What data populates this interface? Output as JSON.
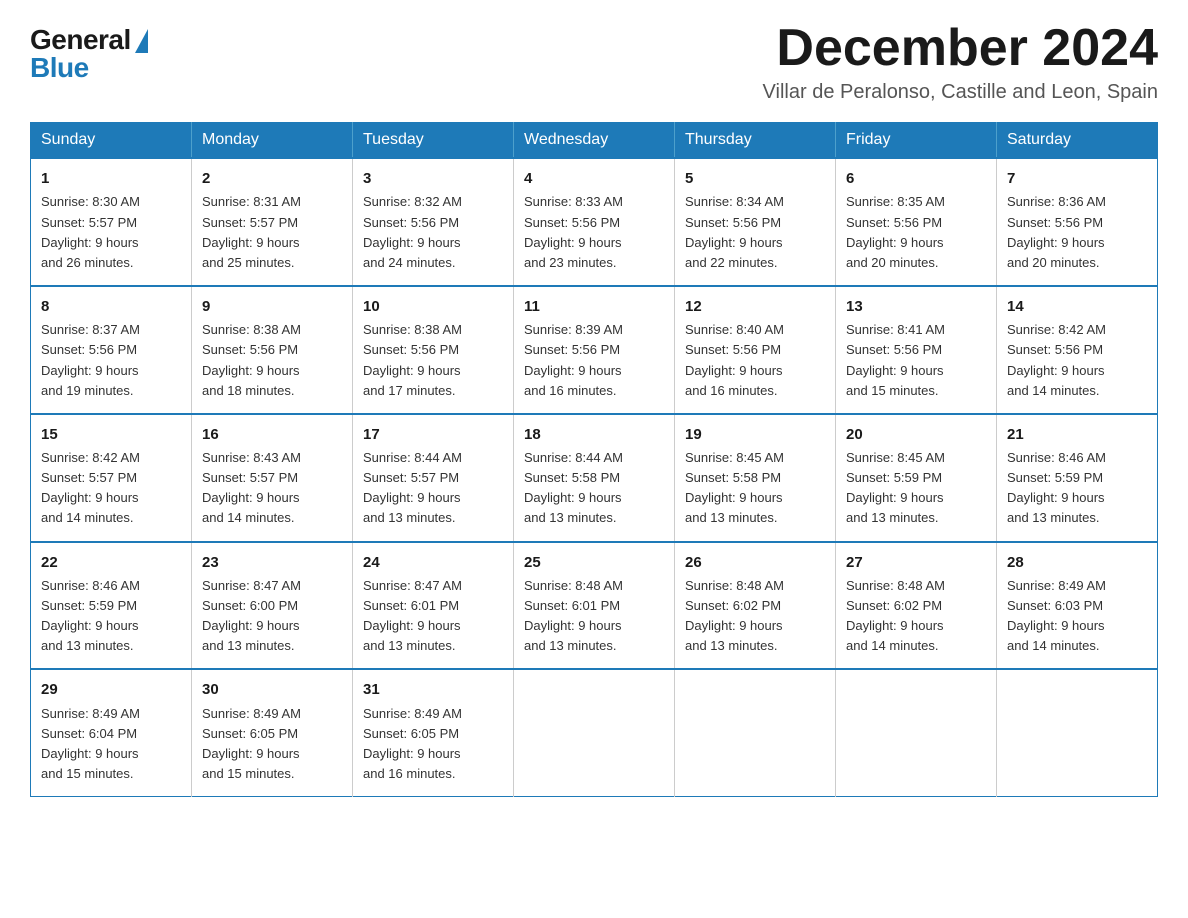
{
  "logo": {
    "general": "General",
    "blue": "Blue"
  },
  "title": "December 2024",
  "subtitle": "Villar de Peralonso, Castille and Leon, Spain",
  "days_header": [
    "Sunday",
    "Monday",
    "Tuesday",
    "Wednesday",
    "Thursday",
    "Friday",
    "Saturday"
  ],
  "weeks": [
    [
      {
        "day": "1",
        "info": "Sunrise: 8:30 AM\nSunset: 5:57 PM\nDaylight: 9 hours\nand 26 minutes."
      },
      {
        "day": "2",
        "info": "Sunrise: 8:31 AM\nSunset: 5:57 PM\nDaylight: 9 hours\nand 25 minutes."
      },
      {
        "day": "3",
        "info": "Sunrise: 8:32 AM\nSunset: 5:56 PM\nDaylight: 9 hours\nand 24 minutes."
      },
      {
        "day": "4",
        "info": "Sunrise: 8:33 AM\nSunset: 5:56 PM\nDaylight: 9 hours\nand 23 minutes."
      },
      {
        "day": "5",
        "info": "Sunrise: 8:34 AM\nSunset: 5:56 PM\nDaylight: 9 hours\nand 22 minutes."
      },
      {
        "day": "6",
        "info": "Sunrise: 8:35 AM\nSunset: 5:56 PM\nDaylight: 9 hours\nand 20 minutes."
      },
      {
        "day": "7",
        "info": "Sunrise: 8:36 AM\nSunset: 5:56 PM\nDaylight: 9 hours\nand 20 minutes."
      }
    ],
    [
      {
        "day": "8",
        "info": "Sunrise: 8:37 AM\nSunset: 5:56 PM\nDaylight: 9 hours\nand 19 minutes."
      },
      {
        "day": "9",
        "info": "Sunrise: 8:38 AM\nSunset: 5:56 PM\nDaylight: 9 hours\nand 18 minutes."
      },
      {
        "day": "10",
        "info": "Sunrise: 8:38 AM\nSunset: 5:56 PM\nDaylight: 9 hours\nand 17 minutes."
      },
      {
        "day": "11",
        "info": "Sunrise: 8:39 AM\nSunset: 5:56 PM\nDaylight: 9 hours\nand 16 minutes."
      },
      {
        "day": "12",
        "info": "Sunrise: 8:40 AM\nSunset: 5:56 PM\nDaylight: 9 hours\nand 16 minutes."
      },
      {
        "day": "13",
        "info": "Sunrise: 8:41 AM\nSunset: 5:56 PM\nDaylight: 9 hours\nand 15 minutes."
      },
      {
        "day": "14",
        "info": "Sunrise: 8:42 AM\nSunset: 5:56 PM\nDaylight: 9 hours\nand 14 minutes."
      }
    ],
    [
      {
        "day": "15",
        "info": "Sunrise: 8:42 AM\nSunset: 5:57 PM\nDaylight: 9 hours\nand 14 minutes."
      },
      {
        "day": "16",
        "info": "Sunrise: 8:43 AM\nSunset: 5:57 PM\nDaylight: 9 hours\nand 14 minutes."
      },
      {
        "day": "17",
        "info": "Sunrise: 8:44 AM\nSunset: 5:57 PM\nDaylight: 9 hours\nand 13 minutes."
      },
      {
        "day": "18",
        "info": "Sunrise: 8:44 AM\nSunset: 5:58 PM\nDaylight: 9 hours\nand 13 minutes."
      },
      {
        "day": "19",
        "info": "Sunrise: 8:45 AM\nSunset: 5:58 PM\nDaylight: 9 hours\nand 13 minutes."
      },
      {
        "day": "20",
        "info": "Sunrise: 8:45 AM\nSunset: 5:59 PM\nDaylight: 9 hours\nand 13 minutes."
      },
      {
        "day": "21",
        "info": "Sunrise: 8:46 AM\nSunset: 5:59 PM\nDaylight: 9 hours\nand 13 minutes."
      }
    ],
    [
      {
        "day": "22",
        "info": "Sunrise: 8:46 AM\nSunset: 5:59 PM\nDaylight: 9 hours\nand 13 minutes."
      },
      {
        "day": "23",
        "info": "Sunrise: 8:47 AM\nSunset: 6:00 PM\nDaylight: 9 hours\nand 13 minutes."
      },
      {
        "day": "24",
        "info": "Sunrise: 8:47 AM\nSunset: 6:01 PM\nDaylight: 9 hours\nand 13 minutes."
      },
      {
        "day": "25",
        "info": "Sunrise: 8:48 AM\nSunset: 6:01 PM\nDaylight: 9 hours\nand 13 minutes."
      },
      {
        "day": "26",
        "info": "Sunrise: 8:48 AM\nSunset: 6:02 PM\nDaylight: 9 hours\nand 13 minutes."
      },
      {
        "day": "27",
        "info": "Sunrise: 8:48 AM\nSunset: 6:02 PM\nDaylight: 9 hours\nand 14 minutes."
      },
      {
        "day": "28",
        "info": "Sunrise: 8:49 AM\nSunset: 6:03 PM\nDaylight: 9 hours\nand 14 minutes."
      }
    ],
    [
      {
        "day": "29",
        "info": "Sunrise: 8:49 AM\nSunset: 6:04 PM\nDaylight: 9 hours\nand 15 minutes."
      },
      {
        "day": "30",
        "info": "Sunrise: 8:49 AM\nSunset: 6:05 PM\nDaylight: 9 hours\nand 15 minutes."
      },
      {
        "day": "31",
        "info": "Sunrise: 8:49 AM\nSunset: 6:05 PM\nDaylight: 9 hours\nand 16 minutes."
      },
      {
        "day": "",
        "info": ""
      },
      {
        "day": "",
        "info": ""
      },
      {
        "day": "",
        "info": ""
      },
      {
        "day": "",
        "info": ""
      }
    ]
  ]
}
